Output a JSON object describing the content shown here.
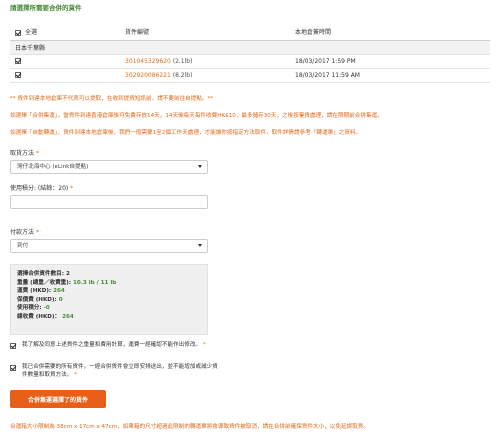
{
  "header": {
    "title": "請選擇所需要合併的貨件"
  },
  "table": {
    "col_select_all": "全選",
    "col_tracking": "貨件編號",
    "col_time": "本地倉簽時間",
    "group": "日本千葉縣",
    "rows": [
      {
        "tracking": "301045329620",
        "weight": "(2.1lb)",
        "time": "18/03/2017 1:59 PM",
        "checked": true
      },
      {
        "tracking": "302920086221",
        "weight": "(8.2lb)",
        "time": "18/03/2017 11:59 AM",
        "checked": true
      }
    ]
  },
  "notices": {
    "n1": "** 貨件到達本地倉庫不代表可以提取，在收到提貨短訊前，請不要前往自提點。**",
    "n2": "如選擇「合併集運」，當貨件到達香港倉庫後可免費存放14天，14天後每天每件收費HK$10，最多儲存30天，之後按棄貨處理，請在限期前合併集運。",
    "n3": "如選擇「自動轉運」，貨件到達本地倉庫後，我們一般需要1至2個工作天處理，才能讓你按指定方法取件，取件詳情請參考「轉運單」之資料。"
  },
  "pickup": {
    "label": "取貨方法",
    "value": "灣仔北海中心 (eLink自提點)"
  },
  "points": {
    "label": "使用積分: (結餘：20)"
  },
  "payment": {
    "label": "付款方法",
    "value": "到付"
  },
  "summary": {
    "count_label": "選擇合併貨件數目:",
    "count_value": "2",
    "weight_label": "重量 (總重／收費重):",
    "weight_value": "10.3 lb / 11 lb",
    "shipping_label": "運費 (HKD):",
    "shipping_value": "264",
    "insurance_label": "保價費 (HKD):",
    "insurance_value": "0",
    "points_label": "使用積分:",
    "points_value": "-0",
    "total_label": "總收費 (HKD)：",
    "total_value": "264"
  },
  "agree": {
    "a1": "我了解及同意上述貨件之重量和費用計算，運費一經確認不能作出修改。",
    "a2": "我已合併需要的所有貨件，一經合併貨件會立即安排送出，並不能增加或減少貨件數量和取貨方法。"
  },
  "submit_label": "合併集運選擇了的貨件",
  "footer": "合運箱大小限制為 38cm x 17cm x 47cm，如果箱的尺寸超過此限制的轉運單將會導致貨件被取消，請在合併前確保貨件大小，以免延誤取貨。"
}
